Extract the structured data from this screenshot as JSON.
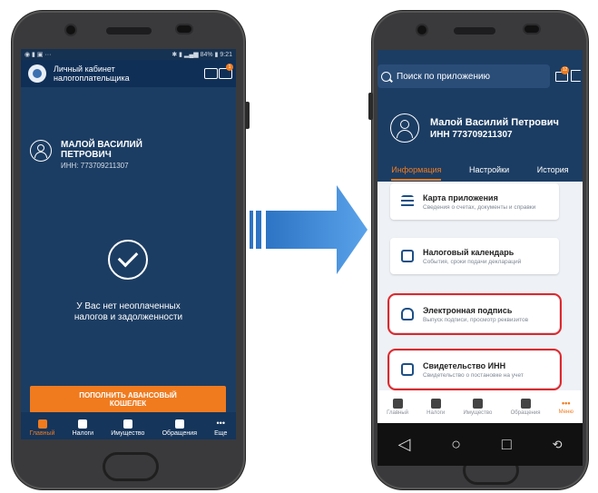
{
  "left": {
    "status_time": "9:21",
    "status_battery": "84%",
    "app_title": "Личный кабинет налогоплательщика",
    "user_name": "МАЛОЙ ВАСИЛИЙ ПЕТРОВИЧ",
    "user_inn": "ИНН: 773709211307",
    "message": "У Вас нет неоплаченных налогов и задолженности",
    "topup_button": "ПОПОЛНИТЬ АВАНСОВЫЙ КОШЕЛЕК",
    "nav": [
      "Главный",
      "Налоги",
      "Имущество",
      "Обращения",
      "Еще"
    ],
    "notification_badge": "1"
  },
  "right": {
    "search_placeholder": "Поиск по приложению",
    "mail_badge": "12",
    "user_name": "Малой Василий Петрович",
    "user_inn": "ИНН 773709211307",
    "tabs": [
      "Информация",
      "Настройки",
      "История"
    ],
    "cards": [
      {
        "title": "Карта приложения",
        "subtitle": "Сведения о счетах, документы и справки"
      },
      {
        "title": "Налоговый календарь",
        "subtitle": "События, сроки подачи деклараций"
      },
      {
        "title": "Электронная подпись",
        "subtitle": "Выпуск подписи, просмотр реквизитов"
      },
      {
        "title": "Свидетельство ИНН",
        "subtitle": "Свидетельство о постановке на учет"
      }
    ],
    "nav": [
      "Главный",
      "Налоги",
      "Имущество",
      "Обращения",
      "Меню"
    ],
    "menu_dots": "•••"
  },
  "colors": {
    "accent": "#f07b1f",
    "header": "#1c3d63",
    "highlight": "#e0262b"
  }
}
